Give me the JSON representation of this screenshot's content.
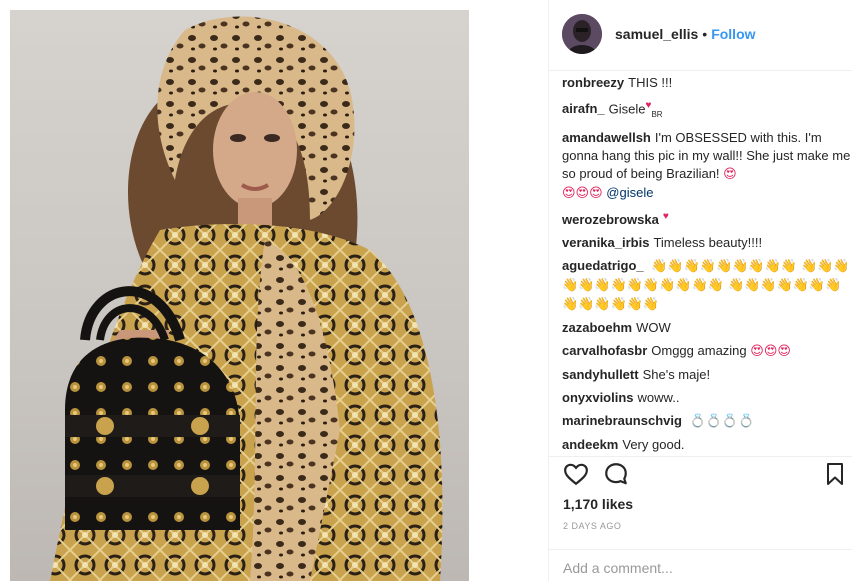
{
  "post": {
    "username": "samuel_ellis",
    "separator": "•",
    "follow_label": "Follow",
    "likes_text": "1,170 likes",
    "date_text": "2 DAYS AGO",
    "add_comment_placeholder": "Add a comment...",
    "image_alt": "Fashion photo of a woman in a leopard-print headscarf and baroque print outfit holding a black studded handbag"
  },
  "comments": [
    {
      "user": "ronbreezy",
      "text": "THIS !!!"
    },
    {
      "user": "airafn_",
      "text": "Gisele",
      "suffix": "BR"
    },
    {
      "user": "amandawellsh",
      "text": "I'm OBSESSED with this. I'm gonna hang this pic in my wall!! She just make me so proud of being Brazilian!",
      "mention": "@gisele"
    },
    {
      "user": "werozebrowska",
      "text": ""
    },
    {
      "user": "veranika_irbis",
      "text": "Timeless beauty!!!!"
    },
    {
      "user": "aguedatrigo_",
      "text": ""
    },
    {
      "user": "zazaboehm",
      "text": "WOW"
    },
    {
      "user": "carvalhofasbr",
      "text": "Omggg amazing"
    },
    {
      "user": "sandyhullett",
      "text": "She's maje!"
    },
    {
      "user": "onyxviolins",
      "text": "woww.."
    },
    {
      "user": "marinebraunschvig",
      "text": ""
    },
    {
      "user": "andeekm",
      "text": "Very good."
    }
  ],
  "icons": {
    "like": "heart-outline",
    "comment": "speech-bubble",
    "save": "bookmark"
  },
  "colors": {
    "follow": "#3897f0",
    "text": "#262626",
    "muted": "#999999",
    "border": "#efefef"
  }
}
